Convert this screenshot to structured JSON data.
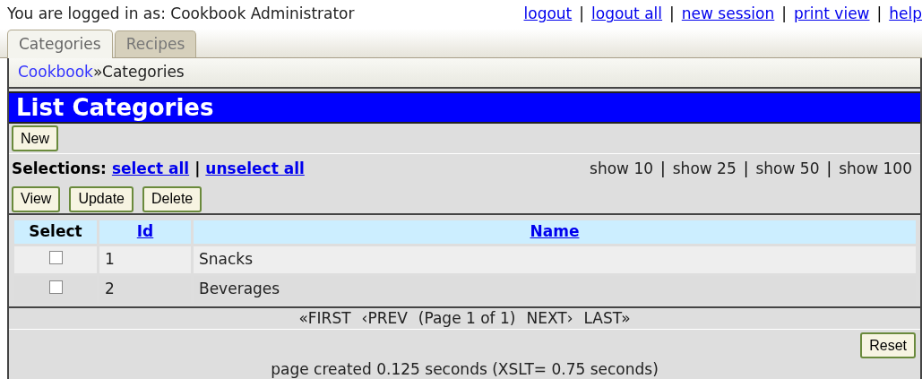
{
  "login_text": "You are logged in as: Cookbook Administrator",
  "top_links": [
    "logout",
    "logout all",
    "new session",
    "print view",
    "help"
  ],
  "link_separator": "|",
  "tabs": [
    {
      "label": "Categories",
      "selected": true
    },
    {
      "label": "Recipes",
      "selected": false
    }
  ],
  "breadcrumb": {
    "link": "Cookbook",
    "separator": "»",
    "current": "Categories"
  },
  "title": "List Categories",
  "new_button": "New",
  "selections": {
    "label": "Selections:",
    "links": [
      "select all",
      "unselect all"
    ]
  },
  "page_sizes": [
    "show 10",
    "show 25",
    "show 50",
    "show 100"
  ],
  "action_buttons": [
    "View",
    "Update",
    "Delete"
  ],
  "table": {
    "columns": [
      {
        "label": "Select",
        "sortable": false
      },
      {
        "label": "Id",
        "sortable": true
      },
      {
        "label": "Name",
        "sortable": true
      }
    ],
    "rows": [
      {
        "checked": false,
        "id": "1",
        "name": "Snacks"
      },
      {
        "checked": false,
        "id": "2",
        "name": "Beverages"
      }
    ]
  },
  "pagination": [
    "«FIRST",
    "‹PREV",
    "(Page 1 of 1)",
    "NEXT›",
    "LAST»"
  ],
  "reset_button": "Reset",
  "footer": "page created 0.125 seconds (XSLT= 0.75 seconds)"
}
